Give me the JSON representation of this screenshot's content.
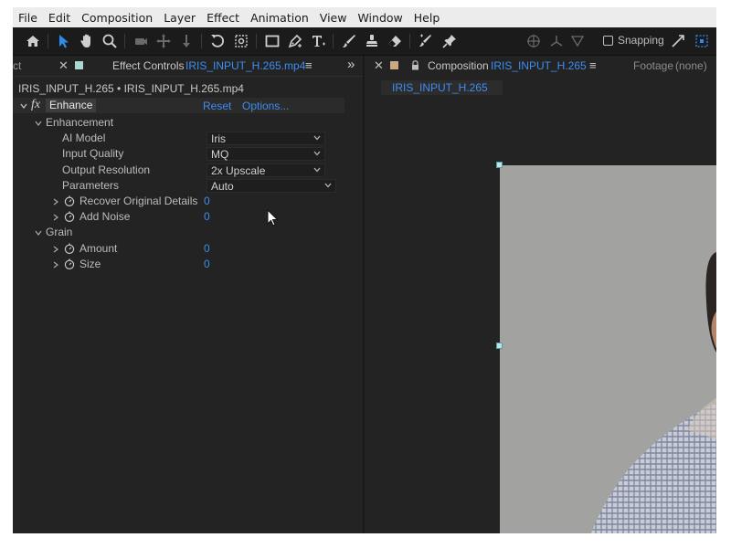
{
  "menu": [
    "File",
    "Edit",
    "Composition",
    "Layer",
    "Effect",
    "Animation",
    "View",
    "Window",
    "Help"
  ],
  "toolbar": {
    "snapping_label": "Snapping",
    "icons": [
      "home-icon",
      "selection-tool-icon",
      "hand-tool-icon",
      "zoom-tool-icon",
      "orbit-camera-icon",
      "pan-camera-icon",
      "dolly-camera-icon",
      "rotation-tool-icon",
      "pan-behind-icon",
      "rectangle-tool-icon",
      "pen-tool-icon",
      "type-tool-icon",
      "brush-tool-icon",
      "clone-stamp-icon",
      "eraser-tool-icon",
      "roto-brush-icon",
      "puppet-pin-icon",
      "align-icon",
      "snap-expand-icon",
      "snap-grid-icon"
    ]
  },
  "left_panel": {
    "partial_tab": "ct",
    "tab_title": "Effect Controls",
    "tab_layer": "IRIS_INPUT_H.265.mp4",
    "expand_glyph": "»",
    "layer_path": "IRIS_INPUT_H.265 • IRIS_INPUT_H.265.mp4",
    "effect": {
      "fx_label": "fx",
      "name": "Enhance",
      "reset": "Reset",
      "options": "Options...",
      "groups": [
        {
          "name": "Enhancement",
          "params": [
            {
              "label": "AI Model",
              "type": "dropdown",
              "value": "Iris"
            },
            {
              "label": "Input Quality",
              "type": "dropdown",
              "value": "MQ"
            },
            {
              "label": "Output Resolution",
              "type": "dropdown",
              "value": "2x Upscale"
            },
            {
              "label": "Parameters",
              "type": "dropdown",
              "value": "Auto"
            },
            {
              "label": "Recover Original Details",
              "type": "number",
              "value": "0"
            },
            {
              "label": "Add Noise",
              "type": "number",
              "value": "0"
            }
          ]
        },
        {
          "name": "Grain",
          "params": [
            {
              "label": "Amount",
              "type": "number",
              "value": "0"
            },
            {
              "label": "Size",
              "type": "number",
              "value": "0"
            }
          ]
        }
      ]
    }
  },
  "right_panel": {
    "tab_title": "Composition",
    "tab_comp": "IRIS_INPUT_H.265",
    "footage_label": "Footage",
    "footage_value": "(none)",
    "comp_chip": "IRIS_INPUT_H.265"
  },
  "colors": {
    "accent": "#3d8df0",
    "panel_bg": "#232323",
    "effect_controls_swatch": "#a9d8d0",
    "composition_swatch": "#c9a882",
    "frame_bg": "#a2a3a0"
  }
}
